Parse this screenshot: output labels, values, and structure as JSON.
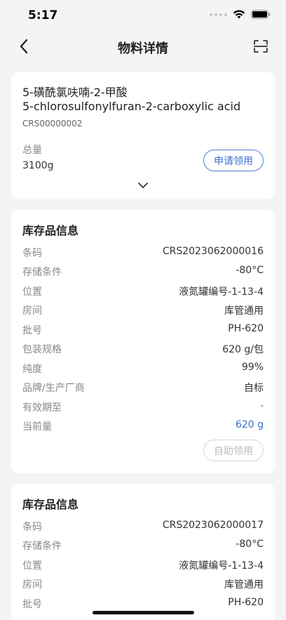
{
  "status_bar": {
    "time": "5:17"
  },
  "nav": {
    "title": "物料详情",
    "back_icon": "chevron-left-icon",
    "scan_icon": "scan-icon"
  },
  "material": {
    "name_cn": "5-磺酰氯呋喃-2-甲酸",
    "name_en": "5-chlorosulfonylfuran-2-carboxylic acid",
    "code": "CRS00000002",
    "total_label": "总量",
    "total_value": "3100g",
    "apply_label": "申请领用"
  },
  "inventory": [
    {
      "title": "库存品信息",
      "rows": [
        {
          "label": "条码",
          "value": "CRS2023062000016"
        },
        {
          "label": "存储条件",
          "value": "-80°C"
        },
        {
          "label": "位置",
          "value": "液氮罐编号-1-13-4"
        },
        {
          "label": "房间",
          "value": "库管通用"
        },
        {
          "label": "批号",
          "value": "PH-620"
        },
        {
          "label": "包装规格",
          "value": "620 g/包"
        },
        {
          "label": "纯度",
          "value": "99%"
        },
        {
          "label": "品牌/生产厂商",
          "value": "自标"
        },
        {
          "label": "有效期至",
          "value": "-"
        },
        {
          "label": "当前量",
          "value": "620 g"
        }
      ],
      "self_apply_label": "自助领用"
    },
    {
      "title": "库存品信息",
      "rows": [
        {
          "label": "条码",
          "value": "CRS2023062000017"
        },
        {
          "label": "存储条件",
          "value": "-80°C"
        },
        {
          "label": "位置",
          "value": "液氮罐编号-1-13-4"
        },
        {
          "label": "房间",
          "value": "库管通用"
        },
        {
          "label": "批号",
          "value": "PH-620"
        }
      ]
    }
  ],
  "colors": {
    "accent": "#3a70cc",
    "background": "#f3f4f6",
    "card": "#ffffff"
  }
}
